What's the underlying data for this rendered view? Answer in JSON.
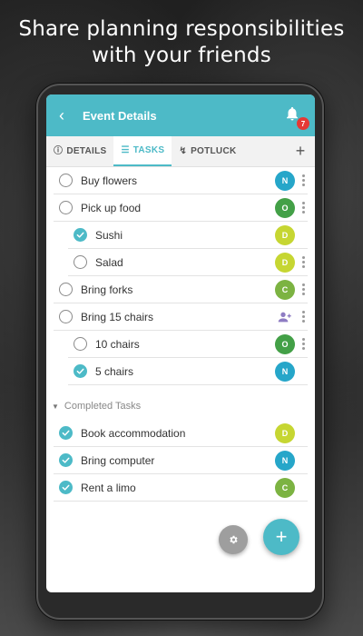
{
  "promo": {
    "line1": "Share planning responsibilities",
    "line2": "with your friends"
  },
  "app_bar": {
    "title": "Event Details",
    "back_icon": "chevron-left-icon",
    "bell_icon": "bell-icon",
    "notification_count": "7",
    "color": "#4dbac7"
  },
  "tabs": [
    {
      "label": "DETAILS",
      "icon": "info-icon",
      "active": false
    },
    {
      "label": "TASKS",
      "icon": "checklist-icon",
      "active": true
    },
    {
      "label": "POTLUCK",
      "icon": "spoon-icon",
      "active": false
    }
  ],
  "tab_add_label": "+",
  "tasks": [
    {
      "label": "Buy flowers",
      "done": false,
      "sub": false,
      "avatar": "N",
      "avatar_color": "#26a6c9",
      "menu": true
    },
    {
      "label": "Pick up food",
      "done": false,
      "sub": false,
      "avatar": "O",
      "avatar_color": "#43a047",
      "menu": true
    },
    {
      "label": "Sushi",
      "done": true,
      "sub": true,
      "avatar": "D",
      "avatar_color": "#c6d632",
      "menu": false
    },
    {
      "label": "Salad",
      "done": false,
      "sub": true,
      "avatar": "D",
      "avatar_color": "#c6d632",
      "menu": true
    },
    {
      "label": "Bring forks",
      "done": false,
      "sub": false,
      "avatar": "C",
      "avatar_color": "#7cb342",
      "menu": true
    },
    {
      "label": "Bring 15 chairs",
      "done": false,
      "sub": false,
      "avatar": "",
      "avatar_color": "",
      "menu": true
    },
    {
      "label": "10 chairs",
      "done": false,
      "sub": true,
      "avatar": "O",
      "avatar_color": "#43a047",
      "menu": true
    },
    {
      "label": "5 chairs",
      "done": true,
      "sub": true,
      "avatar": "N",
      "avatar_color": "#26a6c9",
      "menu": false
    }
  ],
  "completed_header": "Completed Tasks",
  "completed_tasks": [
    {
      "label": "Book accommodation",
      "done": true,
      "avatar": "D",
      "avatar_color": "#c6d632"
    },
    {
      "label": "Bring computer",
      "done": true,
      "avatar": "N",
      "avatar_color": "#26a6c9"
    },
    {
      "label": "Rent a limo",
      "done": true,
      "avatar": "C",
      "avatar_color": "#7cb342"
    }
  ],
  "fab": {
    "settings_icon": "gear-icon",
    "add_label": "+"
  }
}
